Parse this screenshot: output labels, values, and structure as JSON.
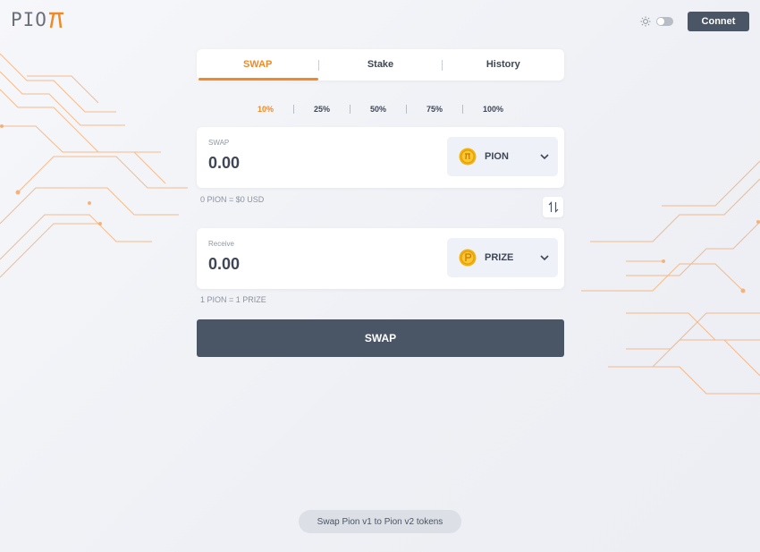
{
  "brand": {
    "logo_text": "PIO",
    "accent_color": "#f08a24",
    "dark_color": "#4a5566"
  },
  "header": {
    "theme_icon": "sun-icon",
    "theme_toggle_on": false,
    "connect_label": "Connet"
  },
  "tabs": [
    {
      "label": "SWAP",
      "active": true
    },
    {
      "label": "Stake",
      "active": false
    },
    {
      "label": "History",
      "active": false
    }
  ],
  "percentages": [
    {
      "label": "10%",
      "active": true
    },
    {
      "label": "25%",
      "active": false
    },
    {
      "label": "50%",
      "active": false
    },
    {
      "label": "75%",
      "active": false
    },
    {
      "label": "100%",
      "active": false
    }
  ],
  "from": {
    "label": "SWAP",
    "value": "0.00",
    "token": "PION",
    "token_icon": "pion-coin-icon",
    "rate_text": "0 PION = $0 USD"
  },
  "to": {
    "label": "Receive",
    "value": "0.00",
    "token": "PRIZE",
    "token_icon": "prize-coin-icon",
    "rate_text": "1 PION = 1 PRIZE"
  },
  "swap_direction_icon": "swap-arrows-icon",
  "swap_button_label": "SWAP",
  "footer_link": "Swap Pion v1 to Pion v2 tokens"
}
